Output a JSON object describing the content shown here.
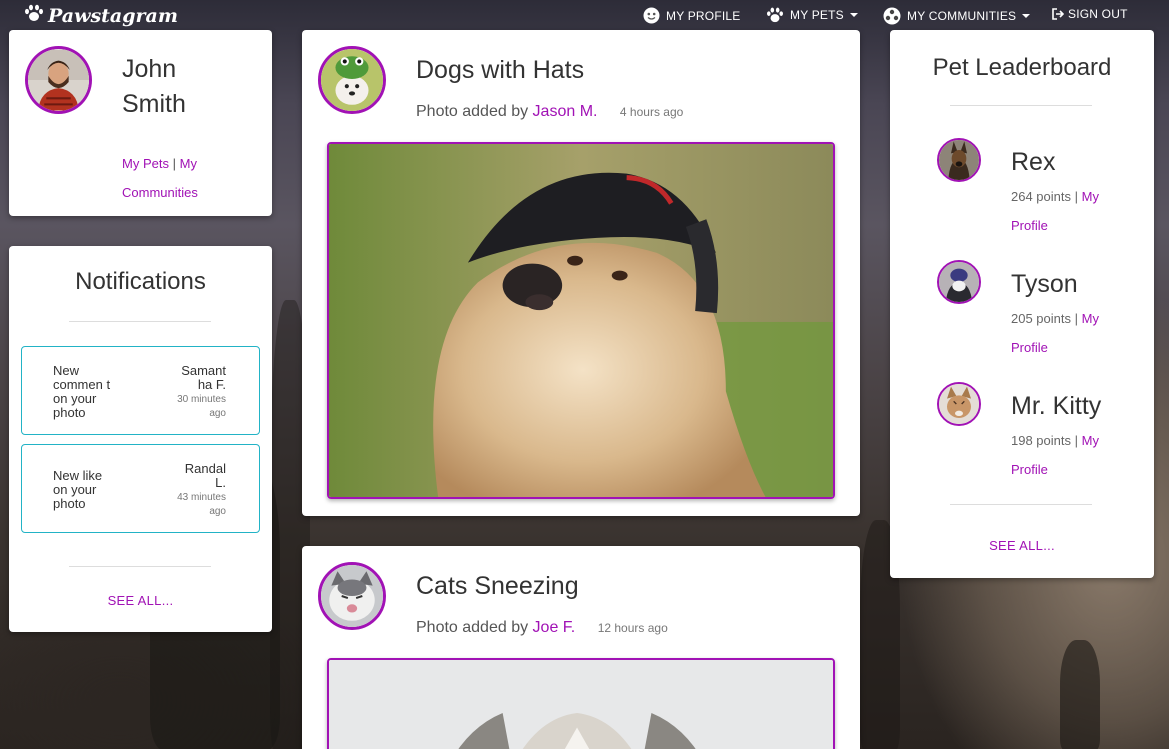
{
  "nav": {
    "brand": "Pawstagram",
    "my_profile": "MY PROFILE",
    "my_pets": "MY PETS",
    "my_communities": "MY COMMUNITIES",
    "sign_out": "SIGN OUT"
  },
  "profile": {
    "first_name": "John",
    "last_name": "Smith",
    "link_pets": "My Pets",
    "separator": "|",
    "link_communities_1": "My",
    "link_communities_2": "Communities"
  },
  "notifications": {
    "title": "Notifications",
    "items": [
      {
        "message": "New commen t on your photo",
        "user": "Samant ha F.",
        "time": "30 minutes ago"
      },
      {
        "message": "New like on your photo",
        "user": "Randal L.",
        "time": "43 minutes ago"
      }
    ],
    "see_all": "SEE ALL..."
  },
  "posts": [
    {
      "title": "Dogs with Hats",
      "meta_prefix": "Photo added by",
      "author": "Jason M.",
      "time": "4 hours ago"
    },
    {
      "title": "Cats Sneezing",
      "meta_prefix": "Photo added by",
      "author": "Joe F.",
      "time": "12 hours ago"
    }
  ],
  "leaderboard": {
    "title": "Pet Leaderboard",
    "items": [
      {
        "name": "Rex",
        "points": "264 points",
        "link_1": "My",
        "link_2": "Profile"
      },
      {
        "name": "Tyson",
        "points": "205 points",
        "link_1": "My",
        "link_2": "Profile"
      },
      {
        "name": "Mr. Kitty",
        "points": "198 points",
        "link_1": "My",
        "link_2": "Profile"
      }
    ],
    "see_all": "SEE ALL..."
  },
  "colors": {
    "accent": "#a112b5",
    "notification_border": "#22b3c6"
  },
  "icons": [
    "paw-icon",
    "smiley-icon",
    "community-icon",
    "sign-out-icon",
    "caret-down-icon"
  ]
}
